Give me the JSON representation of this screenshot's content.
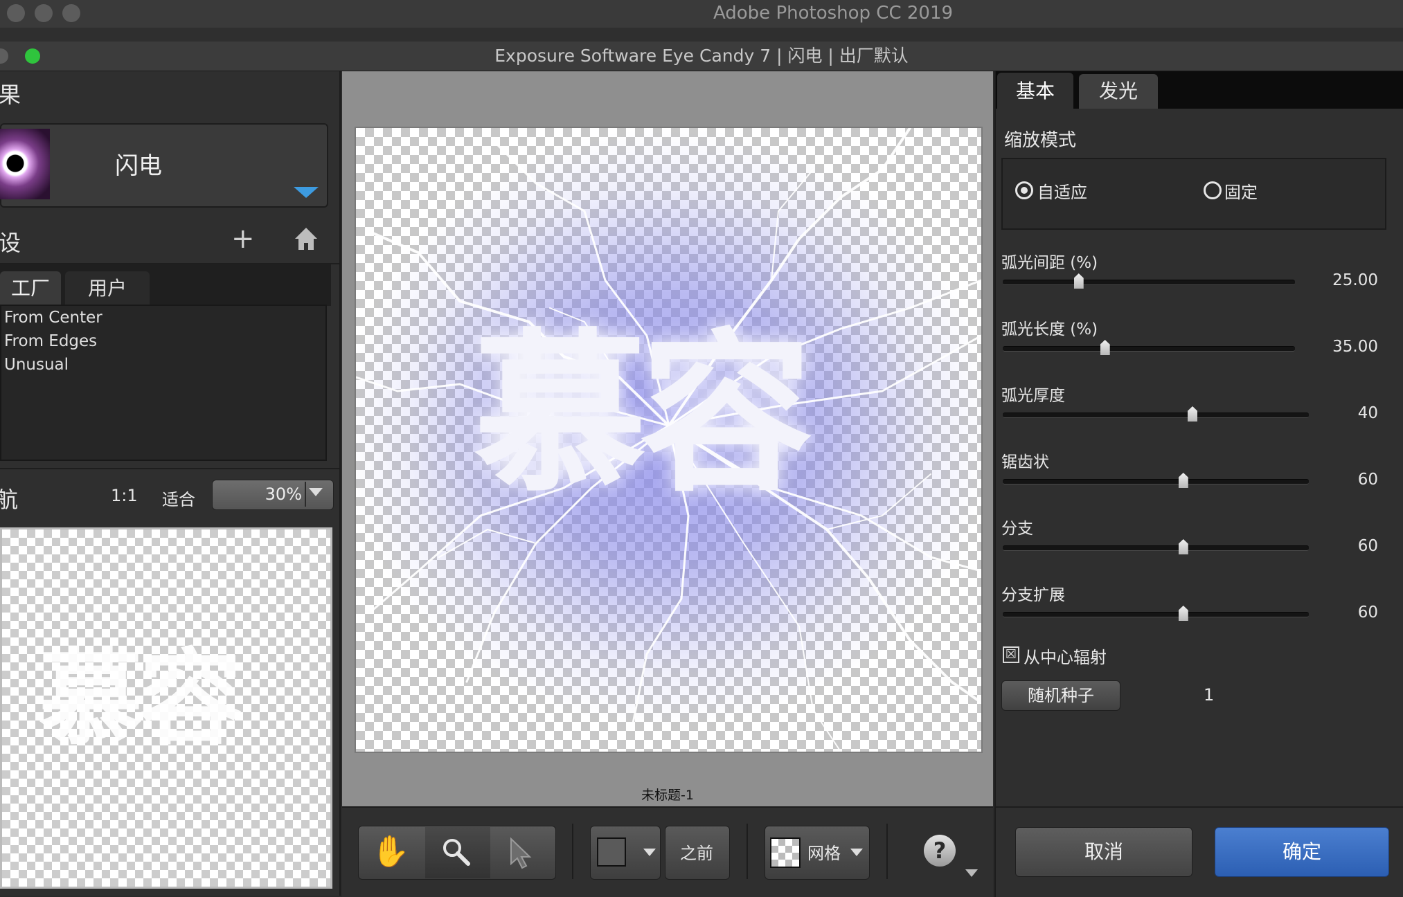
{
  "photoshop": {
    "title": "Adobe Photoshop CC 2019"
  },
  "eyecandy": {
    "title": "Exposure Software Eye Candy 7 | 闪电 | 出厂默认"
  },
  "left": {
    "effects_heading": "果",
    "effect_name": "闪电",
    "presets_heading": "设",
    "preset_tabs": [
      "工厂",
      "用户"
    ],
    "presets": [
      "From Center",
      "From Edges",
      "Unusual"
    ],
    "nav_heading": "航",
    "zoom_1to1": "1:1",
    "zoom_fit": "适合",
    "zoom_value": "30%",
    "nav_preview_text": "慕容"
  },
  "canvas": {
    "image_text": "慕容",
    "document_name": "未标题-1",
    "colors": {
      "glow": "#8c8ceb",
      "background": "#8f8f8f"
    }
  },
  "toolbar": {
    "before_label": "之前",
    "grid_label": "网格",
    "help_label": "?",
    "icons": [
      "hand-icon",
      "zoom-icon",
      "pointer-icon",
      "square-icon",
      "grid-swatch-icon",
      "help-icon"
    ]
  },
  "right": {
    "tabs": [
      "基本",
      "发光"
    ],
    "zoom_mode_label": "缩放模式",
    "zoom_mode_options": [
      "自适应",
      "固定"
    ],
    "zoom_mode_selected": "自适应",
    "params": [
      {
        "label": "弧光间距 (%)",
        "value": "25.00",
        "fraction": 0.26
      },
      {
        "label": "弧光长度 (%)",
        "value": "35.00",
        "fraction": 0.35
      },
      {
        "label": "弧光厚度",
        "value": "40",
        "fraction": 0.62
      },
      {
        "label": "锯齿状",
        "value": "60",
        "fraction": 0.59
      },
      {
        "label": "分支",
        "value": "60",
        "fraction": 0.59
      },
      {
        "label": "分支扩展",
        "value": "60",
        "fraction": 0.59
      }
    ],
    "radiate_label": "从中心辐射",
    "radiate_checked": true,
    "radiate_mark": "☒",
    "seed_button": "随机种子",
    "seed_value": "1",
    "cancel_button": "取消",
    "ok_button": "确定",
    "accent": "#2c5fb3"
  }
}
